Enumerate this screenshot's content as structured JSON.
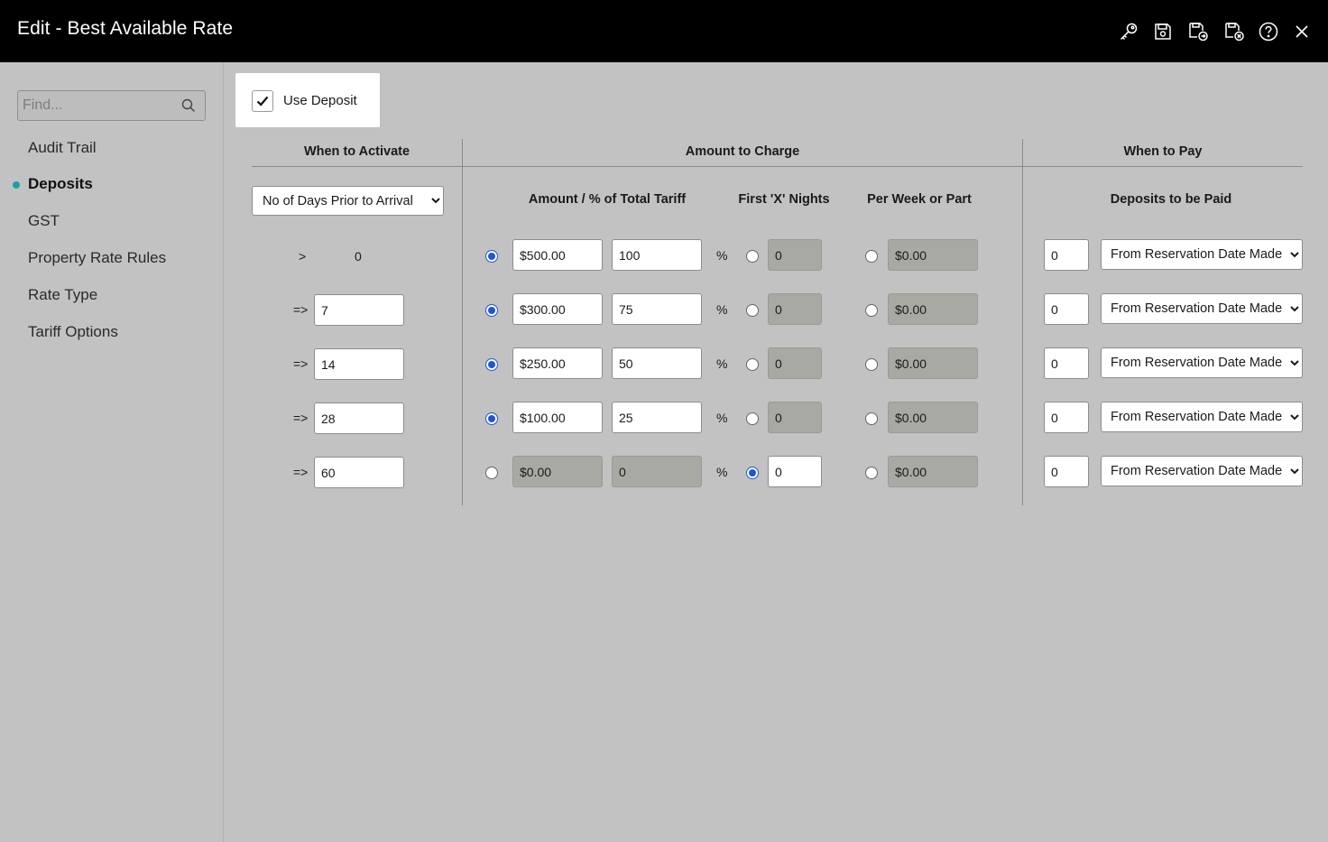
{
  "window": {
    "title": "Edit - Best Available Rate"
  },
  "toolbar": {
    "icons": [
      "key-icon",
      "save-icon",
      "save-and-new-icon",
      "save-and-close-icon",
      "help-icon",
      "close-icon"
    ]
  },
  "sidebar": {
    "search_placeholder": "Find...",
    "items": [
      {
        "label": "Audit Trail"
      },
      {
        "label": "Deposits"
      },
      {
        "label": "GST"
      },
      {
        "label": "Property Rate Rules"
      },
      {
        "label": "Rate Type"
      },
      {
        "label": "Tariff Options"
      }
    ],
    "active_index": 1
  },
  "deposit": {
    "use_deposit_label": "Use Deposit",
    "use_deposit_checked": true,
    "headers": {
      "when_to_activate": "When to Activate",
      "amount_to_charge": "Amount to Charge",
      "when_to_pay": "When to Pay",
      "amount_pct": "Amount / % of Total Tariff",
      "first_x_nights": "First 'X' Nights",
      "per_week": "Per Week or Part",
      "deposits_to_be_paid": "Deposits to be Paid"
    },
    "activate_option": "No of Days Prior to Arrival",
    "pct_symbol": "%",
    "pay_option": "From Reservation Date Made",
    "rows": [
      {
        "op": ">",
        "days": "0",
        "amount": "$500.00",
        "pct": "100",
        "nights": "0",
        "per_week": "$0.00",
        "pay_days": "0"
      },
      {
        "op": "=>",
        "days": "7",
        "amount": "$300.00",
        "pct": "75",
        "nights": "0",
        "per_week": "$0.00",
        "pay_days": "0"
      },
      {
        "op": "=>",
        "days": "14",
        "amount": "$250.00",
        "pct": "50",
        "nights": "0",
        "per_week": "$0.00",
        "pay_days": "0"
      },
      {
        "op": "=>",
        "days": "28",
        "amount": "$100.00",
        "pct": "25",
        "nights": "0",
        "per_week": "$0.00",
        "pay_days": "0"
      },
      {
        "op": "=>",
        "days": "60",
        "amount": "$0.00",
        "pct": "0",
        "nights": "0",
        "per_week": "$0.00",
        "pay_days": "0"
      }
    ],
    "selected_options": [
      "amount",
      "amount",
      "amount",
      "amount",
      "nights"
    ]
  },
  "colors": {
    "titlebar": "#000000",
    "background": "#c2c2c2",
    "radio_selected": "#1e55d8",
    "active_dot": "#1aa0a8"
  }
}
